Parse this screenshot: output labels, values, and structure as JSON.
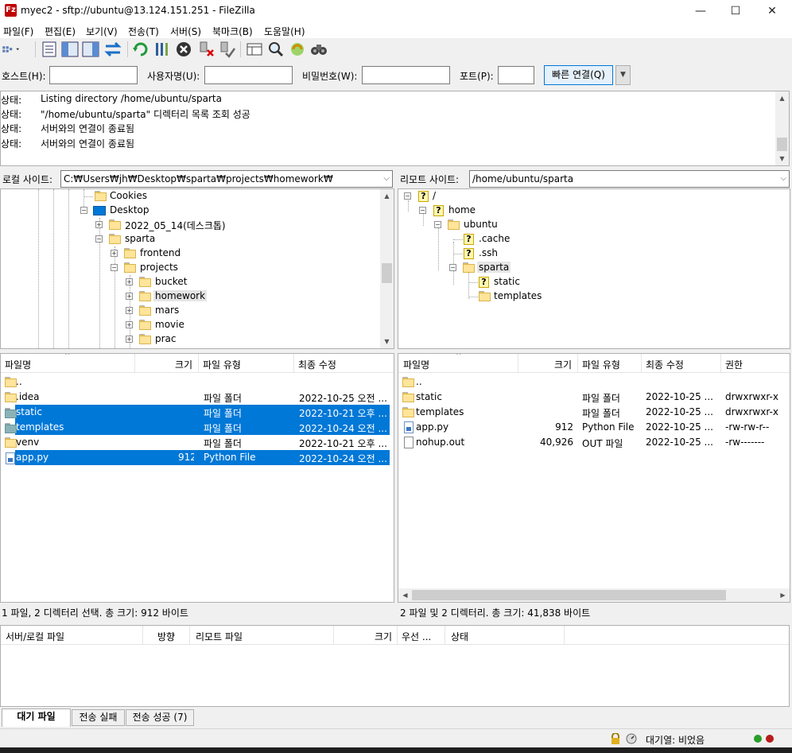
{
  "titlebar": {
    "icon_text": "Fz",
    "title": "myec2 - sftp://ubuntu@13.124.151.251 - FileZilla",
    "minimize": "—",
    "maximize": "☐",
    "close": "✕"
  },
  "menu": [
    "파일(F)",
    "편집(E)",
    "보기(V)",
    "전송(T)",
    "서버(S)",
    "북마크(B)",
    "도움말(H)"
  ],
  "quickconnect": {
    "host_label": "호스트(H):",
    "user_label": "사용자명(U):",
    "pass_label": "비밀번호(W):",
    "port_label": "포트(P):",
    "host_value": "",
    "user_value": "",
    "pass_value": "",
    "port_value": "",
    "connect_button": "빠른 연결(Q)",
    "dropdown": "▼"
  },
  "log": [
    {
      "label": "상태:",
      "msg": "Listing directory /home/ubuntu/sparta"
    },
    {
      "label": "상태:",
      "msg": "\"/home/ubuntu/sparta\" 디렉터리 목록 조회 성공"
    },
    {
      "label": "상태:",
      "msg": "서버와의 연결이 종료됨"
    },
    {
      "label": "상태:",
      "msg": "서버와의 연결이 종료됨"
    }
  ],
  "local": {
    "site_label": "로컬 사이트:",
    "path": "C:₩Users₩jh₩Desktop₩sparta₩projects₩homework₩",
    "tree": [
      {
        "label": "Cookies",
        "type": "folder",
        "expander": ""
      },
      {
        "label": "Desktop",
        "type": "desktop",
        "expander": "−"
      },
      {
        "label": "2022_05_14(데스크톱)",
        "type": "folder",
        "expander": "+"
      },
      {
        "label": "sparta",
        "type": "folder",
        "expander": "−"
      },
      {
        "label": "frontend",
        "type": "folder",
        "expander": "+"
      },
      {
        "label": "projects",
        "type": "folder",
        "expander": "−"
      },
      {
        "label": "bucket",
        "type": "folder",
        "expander": "+"
      },
      {
        "label": "homework",
        "type": "folder",
        "expander": "+",
        "selected": true
      },
      {
        "label": "mars",
        "type": "folder",
        "expander": "+"
      },
      {
        "label": "movie",
        "type": "folder",
        "expander": "+"
      },
      {
        "label": "prac",
        "type": "folder",
        "expander": "+"
      }
    ],
    "columns": [
      "파일명",
      "크기",
      "파일 유형",
      "최종 수정"
    ],
    "files": [
      {
        "name": "..",
        "size": "",
        "type": "",
        "modified": "",
        "icon": "folder",
        "selected": false
      },
      {
        "name": ".idea",
        "size": "",
        "type": "파일 폴더",
        "modified": "2022-10-25 오전 ...",
        "icon": "folder",
        "selected": false
      },
      {
        "name": "static",
        "size": "",
        "type": "파일 폴더",
        "modified": "2022-10-21 오후 ...",
        "icon": "folder-sel",
        "selected": true
      },
      {
        "name": "templates",
        "size": "",
        "type": "파일 폴더",
        "modified": "2022-10-24 오전 ...",
        "icon": "folder-sel",
        "selected": true
      },
      {
        "name": "venv",
        "size": "",
        "type": "파일 폴더",
        "modified": "2022-10-21 오후 ...",
        "icon": "folder",
        "selected": false
      },
      {
        "name": "app.py",
        "size": "912",
        "type": "Python File",
        "modified": "2022-10-24 오전 ...",
        "icon": "python",
        "selected": true
      }
    ],
    "status": "1 파일, 2 디렉터리 선택. 총 크기: 912 바이트"
  },
  "remote": {
    "site_label": "리모트 사이트:",
    "path": "/home/ubuntu/sparta",
    "tree": [
      {
        "label": "/",
        "type": "unknown",
        "expander": "−"
      },
      {
        "label": "home",
        "type": "unknown",
        "expander": "−"
      },
      {
        "label": "ubuntu",
        "type": "folder",
        "expander": "−"
      },
      {
        "label": ".cache",
        "type": "unknown",
        "expander": ""
      },
      {
        "label": ".ssh",
        "type": "unknown",
        "expander": ""
      },
      {
        "label": "sparta",
        "type": "folder",
        "expander": "−",
        "selected": true
      },
      {
        "label": "static",
        "type": "unknown",
        "expander": ""
      },
      {
        "label": "templates",
        "type": "folder",
        "expander": ""
      }
    ],
    "columns": [
      "파일명",
      "크기",
      "파일 유형",
      "최종 수정",
      "권한"
    ],
    "files": [
      {
        "name": "..",
        "size": "",
        "type": "",
        "modified": "",
        "perm": "",
        "icon": "folder"
      },
      {
        "name": "static",
        "size": "",
        "type": "파일 폴더",
        "modified": "2022-10-25 ...",
        "perm": "drwxrwxr-x",
        "icon": "folder"
      },
      {
        "name": "templates",
        "size": "",
        "type": "파일 폴더",
        "modified": "2022-10-25 ...",
        "perm": "drwxrwxr-x",
        "icon": "folder"
      },
      {
        "name": "app.py",
        "size": "912",
        "type": "Python File",
        "modified": "2022-10-25 ...",
        "perm": "-rw-rw-r--",
        "icon": "python"
      },
      {
        "name": "nohup.out",
        "size": "40,926",
        "type": "OUT 파일",
        "modified": "2022-10-25 ...",
        "perm": "-rw-------",
        "icon": "file"
      }
    ],
    "status": "2 파일 및 2 디렉터리. 총 크기: 41,838 바이트"
  },
  "queue": {
    "columns": [
      "서버/로컬 파일",
      "방향",
      "리모트 파일",
      "크기",
      "우선 ...",
      "상태"
    ]
  },
  "tabs": [
    "대기 파일",
    "전송 실패",
    "전송 성공 (7)"
  ],
  "statusbar": {
    "queue_text": "대기열: 비었음"
  }
}
